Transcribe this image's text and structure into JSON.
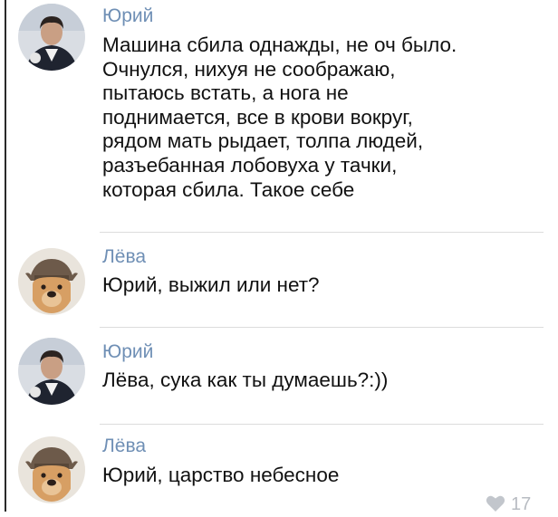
{
  "comments": [
    {
      "author": "Юрий",
      "avatar": "man-photo",
      "lines": [
        "Машина сбила однажды, не оч было.",
        "Очнулся, нихуя не соображаю,",
        "пытаюсь встать, а нога не",
        "поднимается, все в крови вокруг,",
        "рядом мать рыдает, толпа людей,",
        "разъебанная лобовуха у тачки,",
        "которая сбила. Такое себе"
      ]
    },
    {
      "author": "Лёва",
      "avatar": "dog-photo",
      "lines": [
        "Юрий, выжил или нет?"
      ]
    },
    {
      "author": "Юрий",
      "avatar": "man-photo",
      "lines": [
        "Лёва, сука как ты думаешь?:))"
      ]
    },
    {
      "author": "Лёва",
      "avatar": "dog-photo",
      "lines": [
        "Юрий, царство небесное"
      ]
    }
  ],
  "likes": {
    "icon": "heart-icon",
    "count": "17"
  }
}
